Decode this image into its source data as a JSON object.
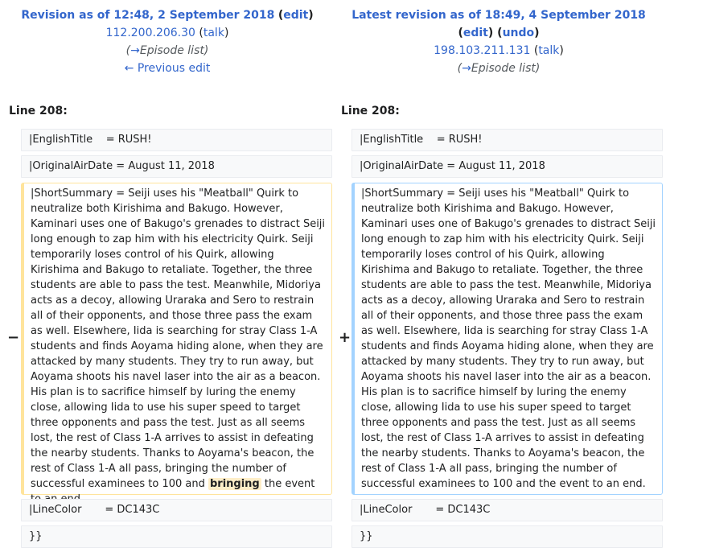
{
  "left_revision": {
    "title": "Revision as of 12:48, 2 September 2018",
    "edit_label": "edit",
    "user": "112.200.206.30",
    "talk_label": "talk",
    "comment_arrow": "→",
    "comment": "Episode list",
    "prev_edit": "← Previous edit"
  },
  "right_revision": {
    "title": "Latest revision as of 18:49, 4 September 2018",
    "edit_label": "edit",
    "undo_label": "undo",
    "user": "198.103.211.131",
    "talk_label": "talk",
    "comment_arrow": "→",
    "comment": "Episode list"
  },
  "diff": {
    "left_line": "Line 208:",
    "right_line": "Line 208:",
    "context_english_title": "|EnglishTitle    = RUSH!",
    "context_air_date": "|OriginalAirDate = August 11, 2018",
    "context_line_color": "|LineColor       = DC143C",
    "context_close": "}}",
    "minus_marker": "−",
    "plus_marker": "+",
    "old_summary_before": "|ShortSummary    = Seiji uses his \"Meatball\" Quirk to neutralize both Kirishima and Bakugo. However, Kaminari uses one of Bakugo's grenades to distract Seiji long enough to zap him with his electricity Quirk. Seiji temporarily loses control of his Quirk, allowing Kirishima and Bakugo to retaliate. Together, the three students are able to pass the test. Meanwhile, Midoriya acts as a decoy, allowing Uraraka and Sero to restrain all of their opponents, and those three pass the exam as well. Elsewhere, Iida is searching for stray Class 1-A students and finds Aoyama hiding alone, when they are attacked by many students. They try to run away, but Aoyama shoots his navel laser into the air as a beacon. His plan is to sacrifice himself by luring the enemy close, allowing Iida to use his super speed to target three opponents and pass the test. Just as all seems lost, the rest of Class 1-A arrives to assist in defeating the nearby students. Thanks to Aoyama's beacon, the rest of Class 1-A all pass, bringing the number of successful examinees to 100 and ",
    "old_summary_removed": "bringing",
    "old_summary_after": " the event to an end.",
    "new_summary": "|ShortSummary    = Seiji uses his \"Meatball\" Quirk to neutralize both Kirishima and Bakugo. However, Kaminari uses one of Bakugo's grenades to distract Seiji long enough to zap him with his electricity Quirk. Seiji temporarily loses control of his Quirk, allowing Kirishima and Bakugo to retaliate. Together, the three students are able to pass the test. Meanwhile, Midoriya acts as a decoy, allowing Uraraka and Sero to restrain all of their opponents, and those three pass the exam as well. Elsewhere, Iida is searching for stray Class 1-A students and finds Aoyama hiding alone, when they are attacked by many students. They try to run away, but Aoyama shoots his navel laser into the air as a beacon. His plan is to sacrifice himself by luring the enemy close, allowing Iida to use his super speed to target three opponents and pass the test. Just as all seems lost, the rest of Class 1-A arrives to assist in defeating the nearby students. Thanks to Aoyama's beacon, the rest of Class 1-A all pass, bringing the number of successful examinees to 100 and the event to an end."
  },
  "colors": {
    "link": "#3366cc",
    "deleted_border": "#ffe49c",
    "added_border": "#a3d3ff",
    "deleted_highlight": "#feeec8",
    "context_bg": "#f8f9fa"
  }
}
